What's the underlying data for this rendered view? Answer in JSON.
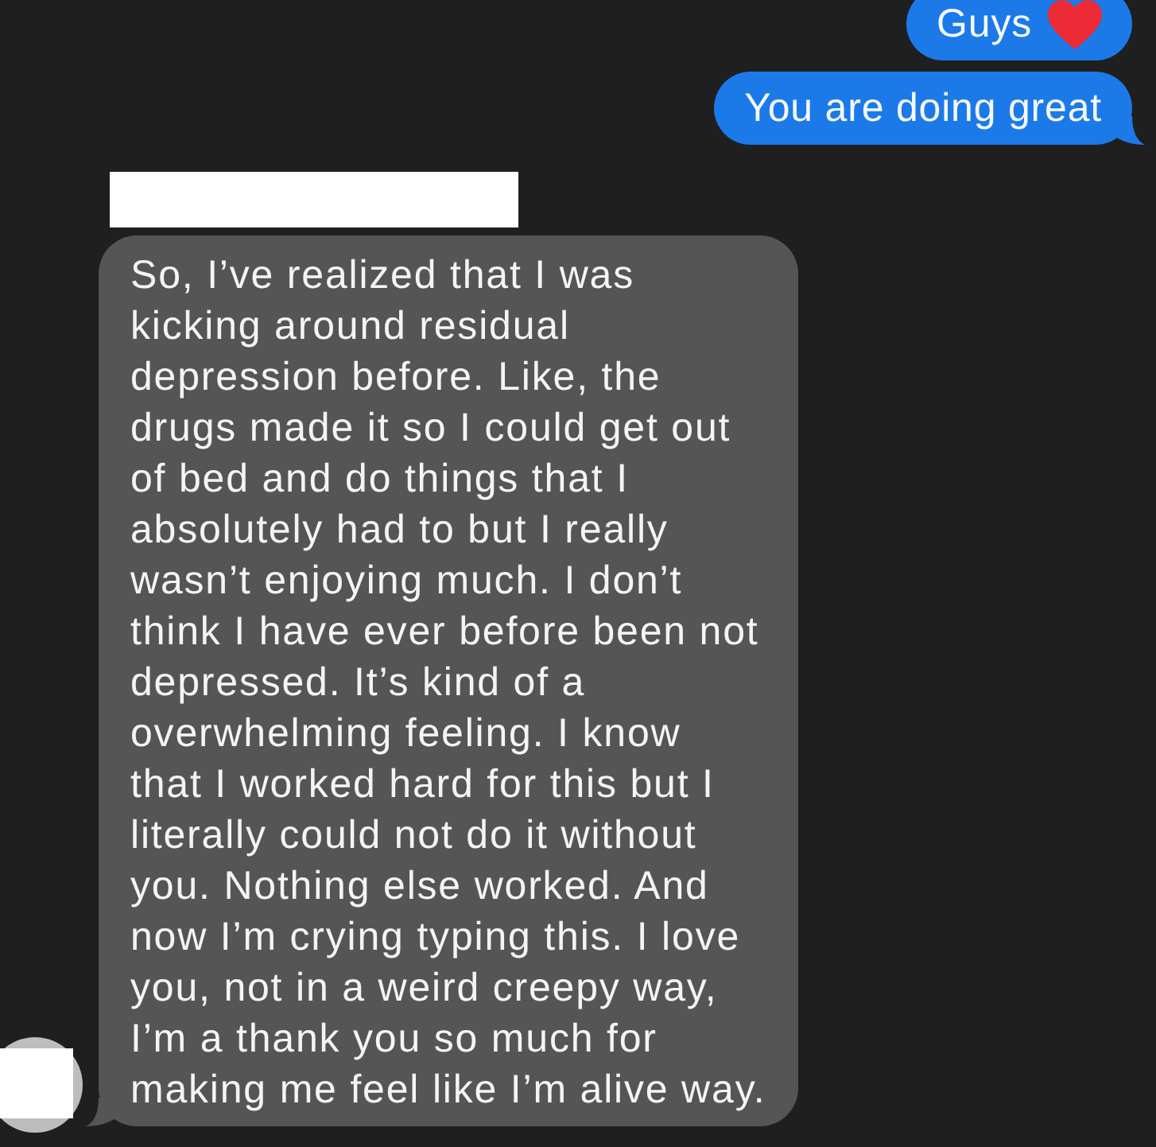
{
  "sent_messages": [
    {
      "kind": "emoji",
      "text": "Guys"
    },
    {
      "kind": "plain",
      "text": "You are doing great"
    }
  ],
  "received_message": {
    "sender_redacted": true,
    "avatar_redacted": true,
    "text_lines": [
      "So, I’ve realized that I was",
      "kicking around residual",
      "depression before. Like, the",
      "drugs made it so I could get out",
      "of bed and do things that I",
      "absolutely had to but I really",
      "wasn’t enjoying much. I don’t",
      "think I have ever before been not",
      "depressed. It’s kind of a",
      "overwhelming feeling. I know",
      "that I worked hard for this but I",
      "literally could not do it without",
      "you. Nothing else worked. And",
      "now I’m crying typing this. I love",
      "you, not in a weird creepy way,",
      "I’m a thank you so much for",
      "making me feel like I’m alive way."
    ]
  }
}
